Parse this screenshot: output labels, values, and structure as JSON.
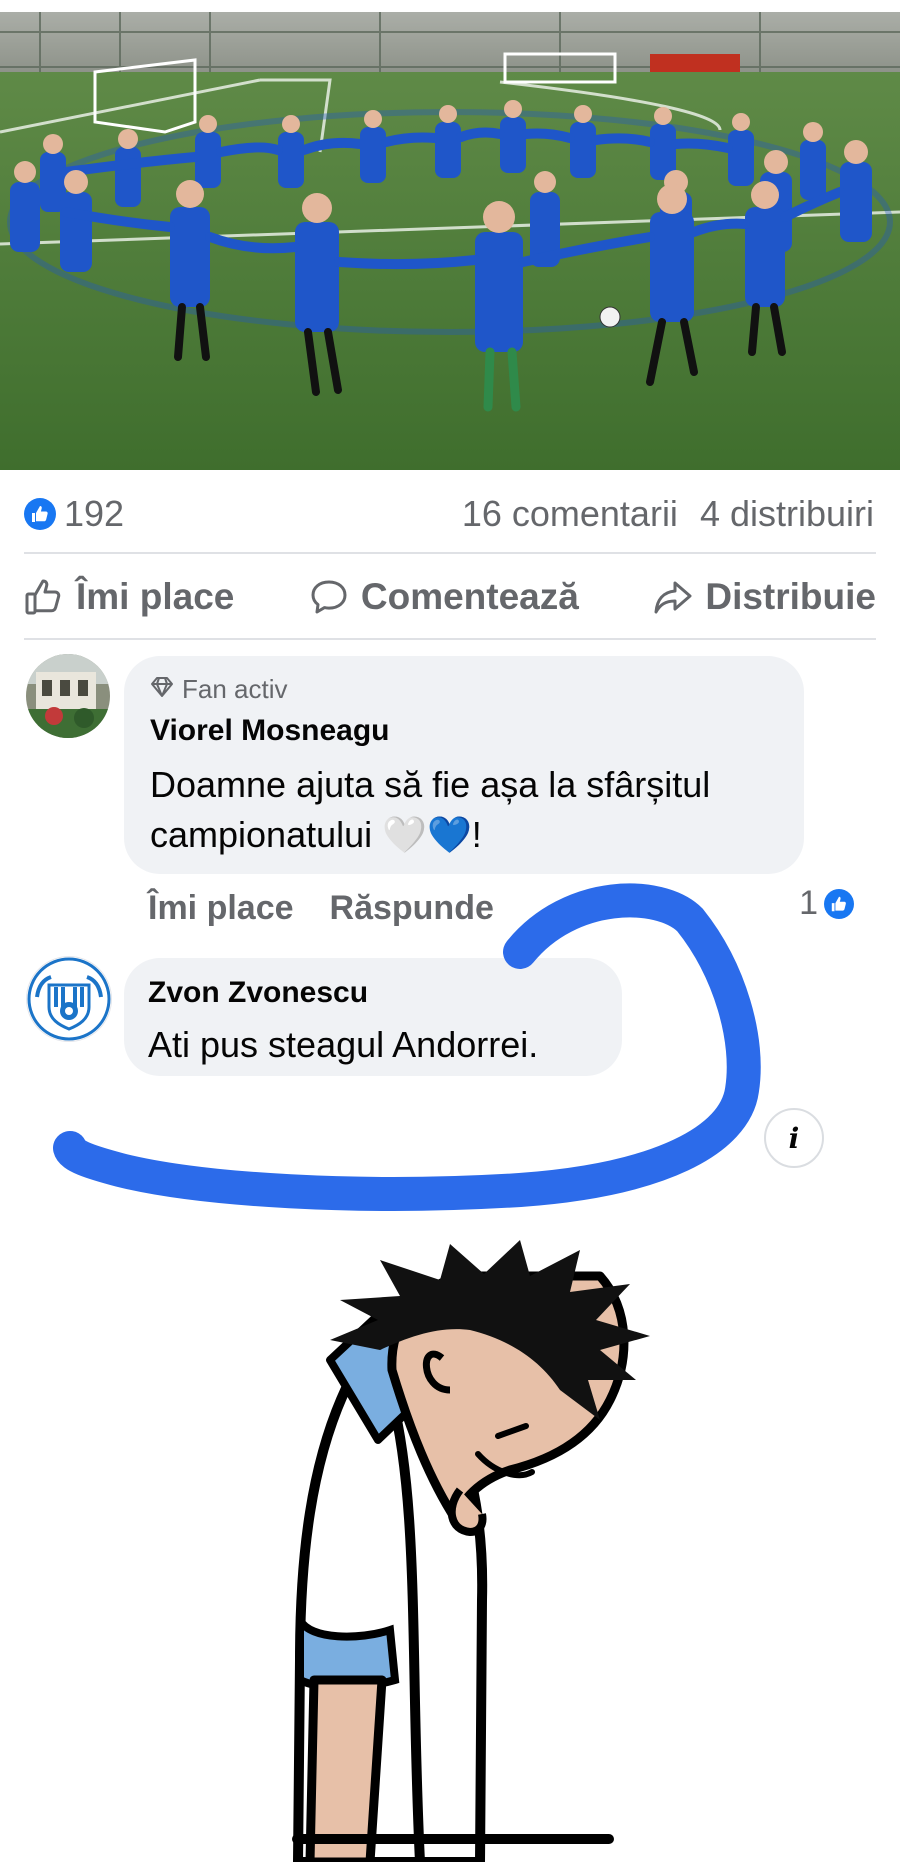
{
  "post": {
    "reactions": {
      "icon": "like-badge-icon",
      "count": "192",
      "comments_label": "16 comentarii",
      "shares_label": "4 distribuiri"
    },
    "actions": {
      "like_label": "Îmi place",
      "comment_label": "Comentează",
      "share_label": "Distribuie"
    }
  },
  "comments": [
    {
      "badge": "Fan activ",
      "author": "Viorel Mosneagu",
      "text": "Doamne ajuta să fie așa la sfârșitul campionatului 🤍💙!",
      "like_action": "Îmi place",
      "reply_action": "Răspunde",
      "likes": "1"
    },
    {
      "author": "Zvon Zvonescu",
      "text": "Ati pus steagul Andorrei."
    }
  ],
  "info_button": {
    "label": "i"
  },
  "colors": {
    "facebook_blue": "#1877f2",
    "text_secondary": "#65676b",
    "bubble_bg": "#f0f2f5",
    "marker_blue": "#2c6bea",
    "jersey_blue": "#1f56c9",
    "pitch_green": "#4f7f3a"
  }
}
